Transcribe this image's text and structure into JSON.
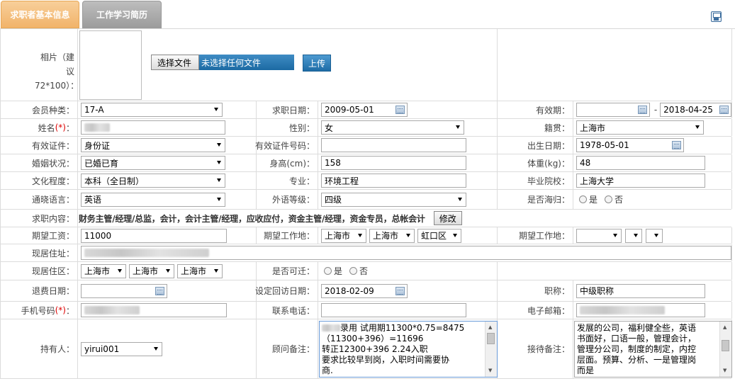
{
  "tabs": [
    {
      "label": "求职者基本信息"
    },
    {
      "label": "工作学习简历"
    }
  ],
  "photo": {
    "label": "相片（建议72*100）：",
    "file_button": "选择文件",
    "file_status": "未选择任何文件",
    "upload_button": "上传"
  },
  "member_type": {
    "label": "会员种类：",
    "value": "17-A"
  },
  "apply_date": {
    "label": "求职日期：",
    "value": "2009-05-01"
  },
  "valid_period": {
    "label": "有效期：",
    "from": "",
    "sep": "-",
    "to": "2018-04-25"
  },
  "name": {
    "label": "姓名",
    "req": "(*)",
    "colon": "："
  },
  "gender": {
    "label": "性别：",
    "value": "女"
  },
  "native": {
    "label": "籍贯：",
    "value": "上海市"
  },
  "id_type": {
    "label": "有效证件：",
    "value": "身份证"
  },
  "id_number": {
    "label": "有效证件号码：",
    "value": ""
  },
  "birth": {
    "label": "出生日期：",
    "value": "1978-05-01"
  },
  "marital": {
    "label": "婚姻状况：",
    "value": "已婚已育"
  },
  "height": {
    "label": "身高(cm)：",
    "value": "158"
  },
  "weight": {
    "label": "体重(kg)：",
    "value": "48"
  },
  "education": {
    "label": "文化程度：",
    "value": "本科（全日制）"
  },
  "major": {
    "label": "专业：",
    "value": "环境工程"
  },
  "school": {
    "label": "毕业院校：",
    "value": "上海大学"
  },
  "language": {
    "label": "通晓语言：",
    "value": "英语"
  },
  "lang_level": {
    "label": "外语等级：",
    "value": "四级"
  },
  "overseas": {
    "label": "是否海归：",
    "yes": "是",
    "no": "否"
  },
  "job_content": {
    "label": "求职内容：",
    "value": "财务主管/经理/总监，会计，会计主管/经理，应收应付，资金主管/经理，资金专员，总帐会计",
    "button": "修改"
  },
  "salary": {
    "label": "期望工资：",
    "value": "11000"
  },
  "work_place1": {
    "label": "期望工作地：",
    "prov": "上海市",
    "city": "上海市",
    "dist": "虹口区"
  },
  "work_place2": {
    "label": "期望工作地：",
    "prov": "",
    "city": "",
    "dist": ""
  },
  "address": {
    "label": "现居住址："
  },
  "residence": {
    "label": "现居住区：",
    "prov": "上海市",
    "city": "上海市",
    "dist": "上海市"
  },
  "relocate": {
    "label": "是否可迁：",
    "yes": "是",
    "no": "否"
  },
  "refund_date": {
    "label": "退费日期：",
    "value": ""
  },
  "revisit_date": {
    "label": "设定回访日期：",
    "value": "2018-02-09"
  },
  "title": {
    "label": "职称：",
    "value": "中级职称"
  },
  "mobile": {
    "label": "手机号码",
    "req": "(*)",
    "colon": "："
  },
  "phone": {
    "label": "联系电话：",
    "value": ""
  },
  "email": {
    "label": "电子邮箱："
  },
  "owner": {
    "label": "持有人：",
    "value": "yirui001"
  },
  "consultant_note": {
    "label": "顾问备注：",
    "lines": [
      "录用 试用期11300*0.75=8475",
      "（11300+396）=11696",
      "转正12300+396 2.24入职",
      "要求比较早到岗，入职时间需要协",
      "商."
    ]
  },
  "reception_note": {
    "label": "接待备注：",
    "lines": [
      "发展的公司，福利健全些，英语",
      "书面好，口语一般，管理会计，",
      "管理分公司，制度的制定，内控",
      "层面。预算、分析、一是管理岗",
      "而是"
    ]
  }
}
